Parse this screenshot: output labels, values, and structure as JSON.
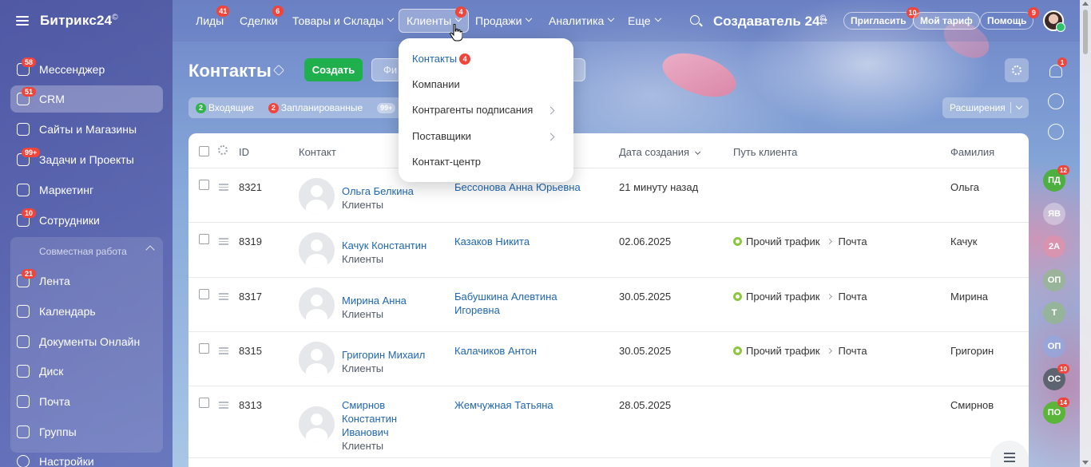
{
  "app": {
    "logo": "Битрикс24",
    "logo_mark": "©"
  },
  "sidebar": {
    "items": [
      {
        "label": "Мессенджер",
        "badge": "58",
        "icon": "chat-icon"
      },
      {
        "label": "CRM",
        "badge": "51",
        "icon": "filter-icon",
        "active": true
      },
      {
        "label": "Сайты и Магазины",
        "badge": "",
        "icon": "store-icon"
      },
      {
        "label": "Задачи и Проекты",
        "badge": "99+",
        "icon": "tasks-icon"
      },
      {
        "label": "Маркетинг",
        "badge": "",
        "icon": "marketing-icon"
      },
      {
        "label": "Сотрудники",
        "badge": "10",
        "icon": "people-icon"
      }
    ],
    "group_title": "Совместная работа",
    "group_items": [
      {
        "label": "Лента",
        "badge": "21",
        "icon": "feed-icon"
      },
      {
        "label": "Календарь",
        "badge": "",
        "icon": "calendar-icon"
      },
      {
        "label": "Документы Онлайн",
        "badge": "",
        "icon": "documents-icon"
      },
      {
        "label": "Диск",
        "badge": "",
        "icon": "disk-icon"
      },
      {
        "label": "Почта",
        "badge": "",
        "icon": "mail-icon"
      },
      {
        "label": "Группы",
        "badge": "",
        "icon": "groups-icon"
      }
    ],
    "settings": "Настройки"
  },
  "topnav": {
    "items": [
      {
        "label": "Лиды",
        "badge": "41"
      },
      {
        "label": "Сделки",
        "badge": "6"
      },
      {
        "label": "Товары и Склады",
        "badge": ""
      },
      {
        "label": "Клиенты",
        "badge": "4",
        "active": true
      },
      {
        "label": "Продажи",
        "badge": ""
      },
      {
        "label": "Аналитика",
        "badge": ""
      },
      {
        "label": "Еще",
        "badge": ""
      }
    ],
    "company": "Создаватель 24",
    "company_mark": "©",
    "invite": "Пригласить",
    "invite_badge": "10",
    "tariff": "Мой тариф",
    "help": "Помощь",
    "help_badge": "9"
  },
  "page": {
    "title": "Контакты",
    "create": "Создать",
    "filter_placeholder": "Фи",
    "counters": [
      {
        "num": "2",
        "label": "Входящие",
        "color": "#2fb54a"
      },
      {
        "num": "2",
        "label": "Запланированные",
        "color": "#f0453b"
      },
      {
        "num": "99+",
        "label": "",
        "color": "gray"
      }
    ],
    "extensions": "Расширения"
  },
  "dropdown": {
    "items": [
      {
        "label": "Контакты",
        "badge": "4",
        "current": true,
        "submenu": false
      },
      {
        "label": "Компании",
        "badge": "",
        "current": false,
        "submenu": false
      },
      {
        "label": "Контрагенты подписания",
        "badge": "",
        "current": false,
        "submenu": true
      },
      {
        "label": "Поставщики",
        "badge": "",
        "current": false,
        "submenu": true
      },
      {
        "label": "Контакт-центр",
        "badge": "",
        "current": false,
        "submenu": false
      }
    ]
  },
  "grid": {
    "columns": {
      "id": "ID",
      "contact": "Контакт",
      "created": "Дата создания",
      "path": "Путь клиента",
      "lastname": "Фамилия"
    },
    "rows": [
      {
        "id": "8321",
        "name": [
          "Ольга Белкина"
        ],
        "type": "Клиенты",
        "responsible": [
          "Бессонова Анна Юрьевна"
        ],
        "created": "21 минуту назад",
        "path_source": "",
        "path_channel": "",
        "lastname": "Ольга"
      },
      {
        "id": "8319",
        "name": [
          "Качук Константин"
        ],
        "type": "Клиенты",
        "responsible": [
          "Казаков Никита"
        ],
        "created": "02.06.2025",
        "path_source": "Прочий трафик",
        "path_channel": "Почта",
        "lastname": "Качук"
      },
      {
        "id": "8317",
        "name": [
          "Мирина Анна"
        ],
        "type": "Клиенты",
        "responsible": [
          "Бабушкина Алевтина",
          "Игоревна"
        ],
        "created": "30.05.2025",
        "path_source": "Прочий трафик",
        "path_channel": "Почта",
        "lastname": "Мирина"
      },
      {
        "id": "8315",
        "name": [
          "Григорин Михаил"
        ],
        "type": "Клиенты",
        "responsible": [
          "Калачиков Антон"
        ],
        "created": "30.05.2025",
        "path_source": "Прочий трафик",
        "path_channel": "Почта",
        "lastname": "Григорин"
      },
      {
        "id": "8313",
        "name": [
          "Смирнов",
          "Константин",
          "Иванович"
        ],
        "type": "Клиенты",
        "responsible": [
          "Жемчужная Татьяна"
        ],
        "created": "28.05.2025",
        "path_source": "",
        "path_channel": "",
        "lastname": "Смирнов"
      }
    ]
  },
  "right_panel": {
    "bell_badge": "1",
    "avatars": [
      {
        "initials": "ПД",
        "badge": "12",
        "color": "#4caf3f"
      },
      {
        "initials": "ЯВ",
        "badge": "",
        "color": "rgba(255,255,255,0.35)"
      },
      {
        "initials": "2А",
        "badge": "",
        "color": "rgba(240,140,160,0.55)"
      },
      {
        "initials": "ОП",
        "badge": "",
        "color": "rgba(140,190,120,0.6)"
      },
      {
        "initials": "Т",
        "badge": "",
        "color": "rgba(140,190,120,0.6)"
      },
      {
        "initials": "ОП",
        "badge": "",
        "color": "rgba(140,170,230,0.6)"
      },
      {
        "initials": "ОС",
        "badge": "10",
        "color": "#5d6470"
      },
      {
        "initials": "ПО",
        "badge": "14",
        "color": "#5bb53b"
      }
    ]
  }
}
